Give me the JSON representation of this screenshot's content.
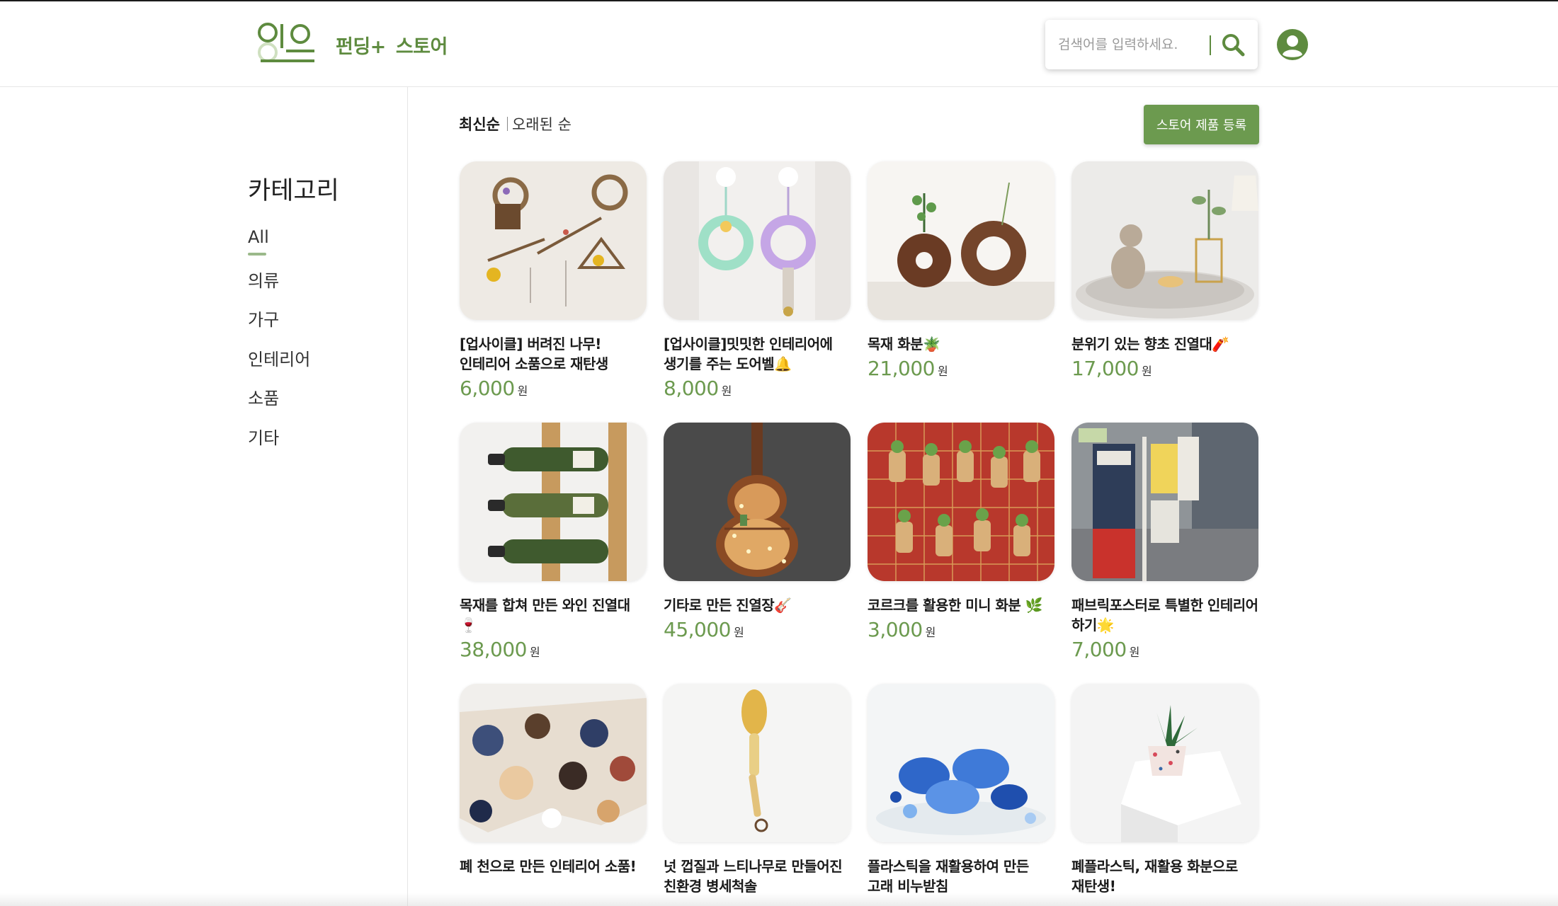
{
  "header": {
    "logo_text": "잇으",
    "nav": [
      "펀딩+",
      "스토어"
    ],
    "search": {
      "placeholder": "검색어를 입력하세요.",
      "value": ""
    },
    "icons": {
      "search": "search-icon",
      "profile": "user-circle-icon"
    },
    "accent_color": "#5e8b3f"
  },
  "sidebar": {
    "title": "카테고리",
    "categories": [
      "All",
      "의류",
      "가구",
      "인테리어",
      "소품",
      "기타"
    ],
    "active_category": "All"
  },
  "sort": {
    "newest": "최신순",
    "oldest": "오래된 순",
    "active": "최신순"
  },
  "register_button": "스토어 제품 등록",
  "price_unit": "원",
  "products": [
    {
      "title": "[업사이클] 버려진 나무! 인테리어 소품으로 재탄생",
      "price": "6,000",
      "image": "wall-wreath-decor"
    },
    {
      "title": "[업사이클]밋밋한 인테리어에 생기를 주는 도어벨🔔",
      "price": "8,000",
      "image": "crochet-doorbell"
    },
    {
      "title": "목재 화분🪴",
      "price": "21,000",
      "image": "wooden-ring-vase"
    },
    {
      "title": "분위기 있는 향초 진열대🧨",
      "price": "17,000",
      "image": "candle-tray-sculpture"
    },
    {
      "title": "목재를 합쳐 만든 와인 진열대🍷",
      "price": "38,000",
      "image": "wood-wine-rack"
    },
    {
      "title": "기타로 만든 진열장🎸",
      "price": "45,000",
      "image": "guitar-shelf"
    },
    {
      "title": "코르크를 활용한 미니 화분 🌿",
      "price": "3,000",
      "image": "cork-mini-pots"
    },
    {
      "title": "패브릭포스터로 특별한 인테리어 하기🌟",
      "price": "7,000",
      "image": "fabric-posters"
    },
    {
      "title": "폐 천으로 만든 인테리어 소품!",
      "price": "",
      "image": "fabric-scrap-tapestry"
    },
    {
      "title": "넛 껍질과 느티나무로 만들어진 친환경 병세척솔",
      "price": "",
      "image": "bottle-brush"
    },
    {
      "title": "플라스틱을 재활용하여 만든 고래 비누받침",
      "price": "",
      "image": "whale-soap-dish"
    },
    {
      "title": "폐플라스틱, 재활용 화분으로 재탄생!",
      "price": "",
      "image": "terrazzo-pot"
    }
  ]
}
